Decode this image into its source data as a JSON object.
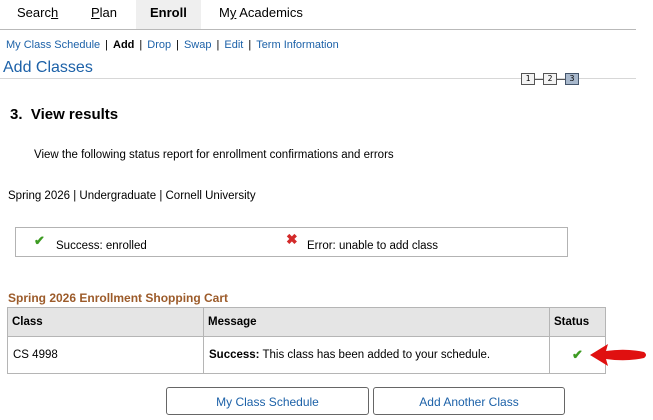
{
  "tabs": [
    {
      "pre": "Searc",
      "underline": "h",
      "post": "",
      "active": false
    },
    {
      "pre": "",
      "underline": "P",
      "post": "lan",
      "active": false
    },
    {
      "pre": "Enroll",
      "underline": "",
      "post": "",
      "active": true
    },
    {
      "pre": "M",
      "underline": "y",
      "post": " Academics",
      "active": false
    }
  ],
  "subnav": {
    "schedule": "My Class Schedule",
    "add": "Add",
    "drop": "Drop",
    "swap": "Swap",
    "edit": "Edit",
    "term_info": "Term Information",
    "separator": "|"
  },
  "page_title": "Add Classes",
  "steps": [
    "1",
    "2",
    "3"
  ],
  "current_step": 3,
  "step_heading": "3.  View results",
  "instructions": "View the following status report for enrollment confirmations and errors",
  "term_line": "Spring 2026 | Undergraduate | Cornell University",
  "legend": {
    "success_label": "Success: enrolled",
    "error_label": "Error: unable to add class",
    "success_color": "#3d9b22",
    "error_color": "#d32a2a"
  },
  "cart": {
    "title": "Spring 2026 Enrollment Shopping Cart",
    "columns": [
      "Class",
      "Message",
      "Status"
    ],
    "rows": [
      {
        "class": "CS 4998",
        "message_bold": "Success:",
        "message": " This class has been added to your schedule.",
        "status": "success"
      }
    ]
  },
  "buttons": {
    "schedule": "My Class Schedule",
    "add_another": "Add Another Class"
  },
  "annotation_arrow_color": "#e01010",
  "icons": {
    "success": "checkmark-icon",
    "error": "x-icon"
  }
}
